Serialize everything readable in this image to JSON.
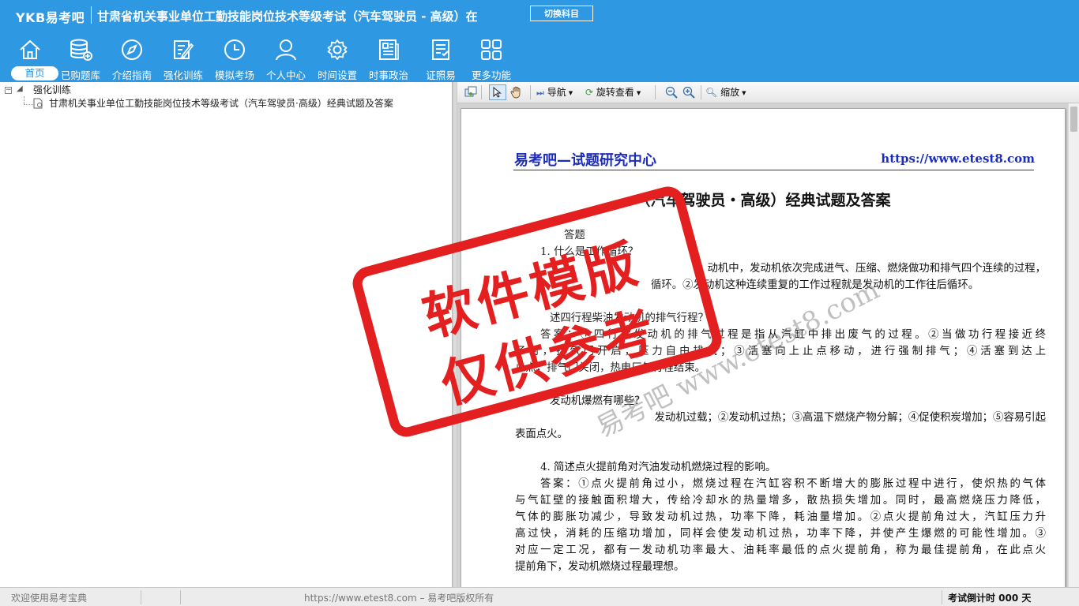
{
  "header": {
    "brand": "YKB易考吧",
    "exam_title": "甘肃省机关事业单位工勤技能岗位技术等级考试（汽车驾驶员 - 高级）在",
    "switch_subject": "切换科目"
  },
  "nav": [
    {
      "label": "首页",
      "icon": "home-icon"
    },
    {
      "label": "已购题库",
      "icon": "database-icon"
    },
    {
      "label": "介绍指南",
      "icon": "compass-icon"
    },
    {
      "label": "强化训练",
      "icon": "edit-icon"
    },
    {
      "label": "模拟考场",
      "icon": "clock-icon"
    },
    {
      "label": "个人中心",
      "icon": "user-icon"
    },
    {
      "label": "时间设置",
      "icon": "gear-icon"
    },
    {
      "label": "时事政治",
      "icon": "news-icon"
    },
    {
      "label": "证照易",
      "icon": "certificate-icon"
    },
    {
      "label": "更多功能",
      "icon": "grid-icon"
    }
  ],
  "tree": {
    "root": "强化训练",
    "child": "甘肃机关事业单位工勤技能岗位技术等级考试（汽车驾驶员·高级）经典试题及答案"
  },
  "toolbar": {
    "navigate": "导航",
    "rotate": "旋转查看",
    "zoom": "缩放"
  },
  "document": {
    "header_left": "易考吧—试题研究中心",
    "header_right": "https://www.etest8.com",
    "title": "（汽车驾驶员・高级）经典试题及答案",
    "lines": [
      "答题",
      "1. 什么是工作循环？",
      "动机中，发动机依次完成进气、压缩、燃烧做功和排气四个连续的过程，",
      "循环。②发动机这种连续重复的工作过程就是发动机的工作往后循环。",
      "述四行程柴油发动机的排气行程？",
      "答案：①四行程发动机的排气过程是指从汽缸中排出废气的过程。②当做功行程接近终",
      "了时，排气门开启，压力自由排气；③活塞向上止点移动，进行强制排气；④活塞到达上",
      "止点，排气门关闭，热电厂气行程结束。",
      "发动机爆燃有哪些？",
      "发动机过载；②发动机过热；③高温下燃烧产物分解；④促使积炭增加；⑤容易引起",
      "表面点火。",
      "4. 简述点火提前角对汽油发动机燃烧过程的影响。",
      "答案：①点火提前角过小，燃烧过程在汽缸容积不断增大的膨胀过程中进行，使炽热的气体",
      "与气缸壁的接触面积增大，传给冷却水的热量增多，散热损失增加。同时，最高燃烧压力降低，",
      "气体的膨胀功减少，导致发动机过热，功率下降，耗油量增加。②点火提前角过大，汽缸压力升",
      "高过快，消耗的压缩功增加，同样会使发动机过热，功率下降，并使产生爆燃的可能性增加。③",
      "对应一定工况，都有一发动机功率最大、油耗率最低的点火提前角，称为最佳提前角，在此点火",
      "提前角下，发动机燃烧过程最理想。"
    ]
  },
  "stamp": {
    "line1": "软件模版",
    "line2": "仅供参考"
  },
  "watermark": "易考吧 www.etest8.com",
  "status": {
    "welcome": "欢迎使用易考宝典",
    "copyright": "https://www.etest8.com – 易考吧版权所有",
    "countdown": "考试倒计时 000 天"
  },
  "colors": {
    "header_bg": "#2f98e3",
    "stamp": "#e31f1f",
    "doc_header": "#1c2dbb"
  }
}
